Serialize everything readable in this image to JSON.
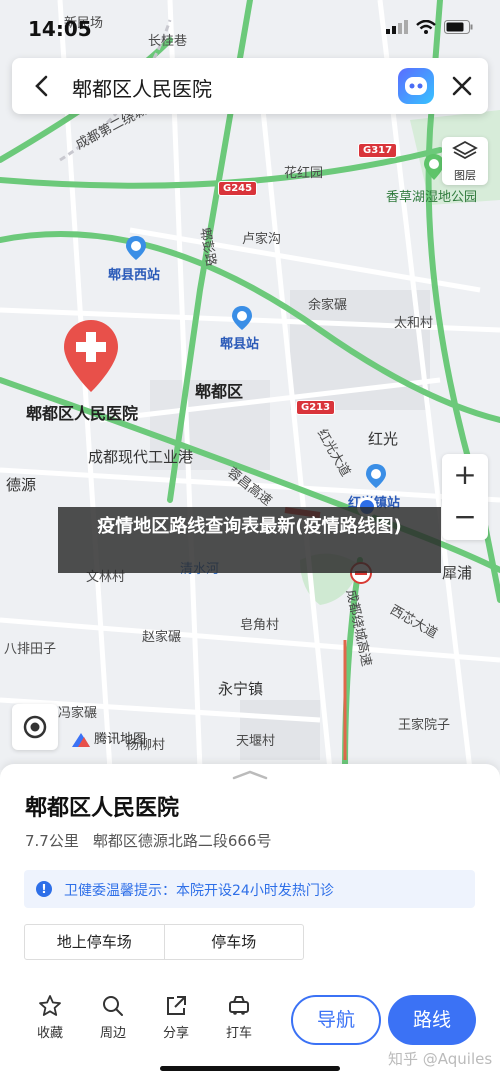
{
  "status": {
    "time": "14:05"
  },
  "search": {
    "query": "郫都区人民医院"
  },
  "map": {
    "layers_label": "图层",
    "zoom_in": "+",
    "zoom_out": "−",
    "provider": "腾讯地图",
    "labels": {
      "xinmin": "新民场",
      "changjiu": "长桂巷",
      "chengdu_ring3": "成都第二绕城",
      "huahongyuan": "花红园",
      "xiangcaohu": "香草湖湿地公园",
      "pidu_road": "郫彭路",
      "lujiagou": "卢家沟",
      "pixian_west": "郫县西站",
      "pixian_station": "郫县站",
      "yujiaqian": "余家碾",
      "taihecun": "太和村",
      "pidu_district": "郫都区",
      "hospital": "郫都区人民医院",
      "hongguang": "红光",
      "hongguang_rd": "红光大道",
      "modern_park": "成都现代工业港",
      "deyuan": "德源",
      "chengguan_rd": "蓉昌高速",
      "hongguang_town": "红光镇站",
      "lianggui": "犀浦",
      "wencun": "文林村",
      "qingshuihe": "清水河",
      "zhaojiaguan": "赵家碾",
      "gaojiadian": "皂角村",
      "tianma": "八排田子",
      "xixinda": "西芯大道",
      "chengrao": "成都绕城高速",
      "yongning": "永宁镇",
      "wangjiayuan": "王家院子",
      "majiazhuang": "冯家碾",
      "tianshou": "天堰村",
      "yiwen": "杨柳村"
    },
    "badges": {
      "g317": "G317",
      "g245": "G245",
      "g213": "G213"
    }
  },
  "overlay": {
    "text": "疫情地区路线查询表最新(疫情路线图)"
  },
  "place": {
    "name": "郫都区人民医院",
    "distance": "7.7公里",
    "address": "郫都区德源北路二段666号",
    "notice": "卫健委温馨提示：本院开设24小时发热门诊",
    "parking_tabs": [
      "地上停车场",
      "停车场"
    ]
  },
  "actions": {
    "favorite": "收藏",
    "nearby": "周边",
    "share": "分享",
    "taxi": "打车",
    "navigate": "导航",
    "route": "路线"
  },
  "watermark": "知乎 @Aquiles",
  "colors": {
    "accent": "#3b72f5",
    "hospital_pin": "#e8504a",
    "road_green": "#5ec46a"
  }
}
